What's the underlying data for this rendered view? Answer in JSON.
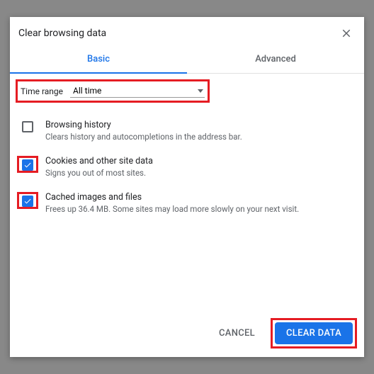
{
  "dialog": {
    "title": "Clear browsing data",
    "tabs": {
      "basic": "Basic",
      "advanced": "Advanced"
    },
    "time_range": {
      "label": "Time range",
      "value": "All time"
    },
    "options": [
      {
        "checked": false,
        "highlight": false,
        "title": "Browsing history",
        "desc": "Clears history and autocompletions in the address bar."
      },
      {
        "checked": true,
        "highlight": true,
        "title": "Cookies and other site data",
        "desc": "Signs you out of most sites."
      },
      {
        "checked": true,
        "highlight": true,
        "title": "Cached images and files",
        "desc": "Frees up 36.4 MB. Some sites may load more slowly on your next visit."
      }
    ],
    "actions": {
      "cancel": "CANCEL",
      "clear": "CLEAR DATA"
    }
  }
}
